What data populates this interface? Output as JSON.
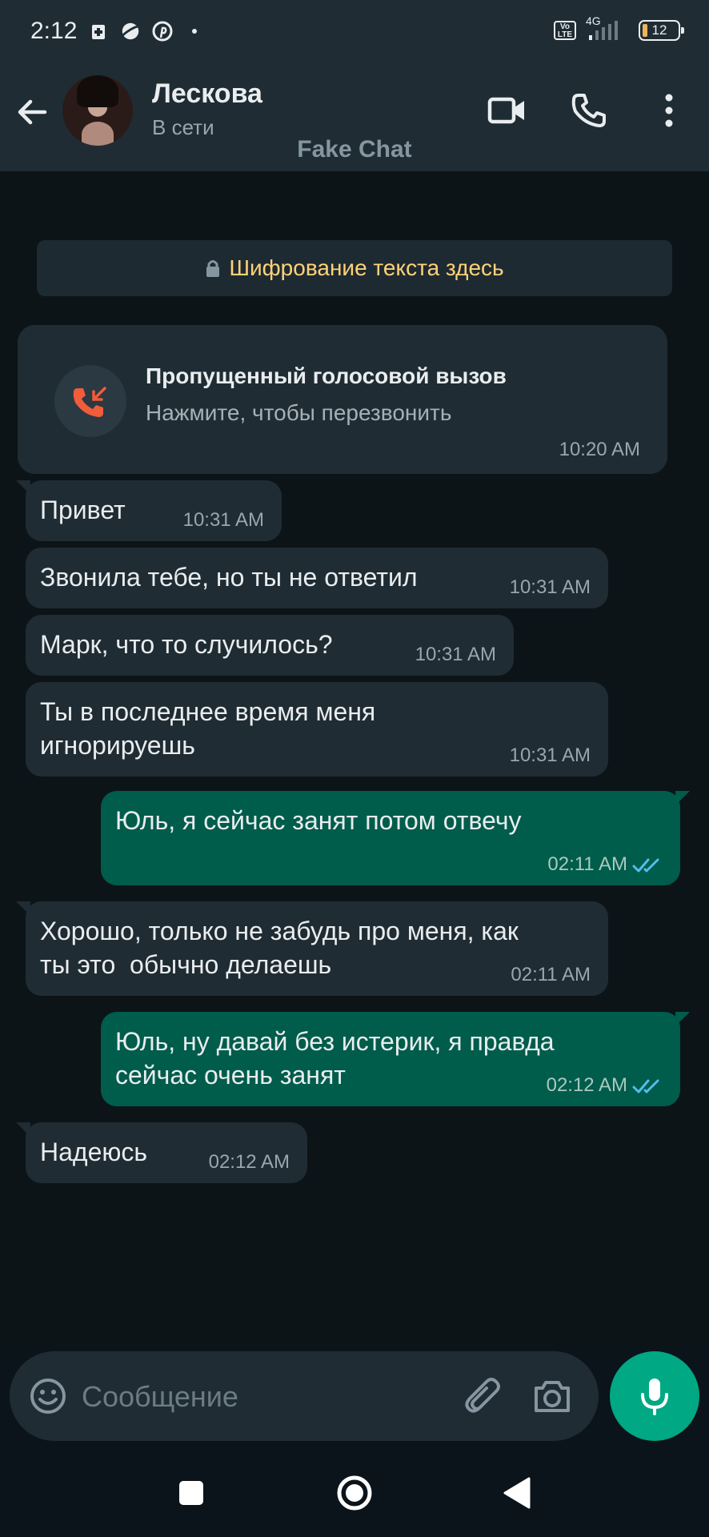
{
  "status_bar": {
    "time": "2:12",
    "network": "4G",
    "volte_label": "Vo LTE",
    "battery": "12",
    "battery_level": 0.12
  },
  "header": {
    "contact_name": "Лескова",
    "contact_status": "В сети",
    "watermark": "Fake Chat"
  },
  "encryption_notice": "Шифрование текста здесь",
  "missed_call": {
    "title": "Пропущенный голосовой вызов",
    "subtitle": "Нажмите, чтобы перезвонить",
    "time": "10:20 AM"
  },
  "messages": [
    {
      "direction": "in",
      "lines": [
        "Привет"
      ],
      "time": "10:31 AM"
    },
    {
      "direction": "in",
      "lines": [
        "Звонила тебе, но ты не ответил"
      ],
      "time": "10:31 AM"
    },
    {
      "direction": "in",
      "lines": [
        "Марк, что то случилось?"
      ],
      "time": "10:31 AM"
    },
    {
      "direction": "in",
      "lines": [
        "Ты в последнее время меня",
        "игнорируешь"
      ],
      "time": "10:31 AM"
    },
    {
      "direction": "out",
      "lines": [
        "Юль, я сейчас занят потом отвечу"
      ],
      "time": "02:11 AM",
      "status": "read"
    },
    {
      "direction": "in",
      "lines": [
        "Хорошо, только не забудь про меня, как",
        "ты это  обычно делаешь"
      ],
      "time": "02:11 AM"
    },
    {
      "direction": "out",
      "lines": [
        "Юль, ну давай без истерик, я правда",
        "сейчас очень занят"
      ],
      "time": "02:12 AM",
      "status": "read"
    },
    {
      "direction": "in",
      "lines": [
        "Надеюсь"
      ],
      "time": "02:12 AM"
    }
  ],
  "composer": {
    "placeholder": "Сообщение"
  },
  "colors": {
    "incoming_bubble": "#202c33",
    "outgoing_bubble": "#005c4b",
    "accent": "#00a884",
    "read_ticks": "#53bdeb",
    "missed_call": "#f15c3b",
    "encryption_text": "#ffd279"
  },
  "icons": {
    "back": "arrow-left-icon",
    "video": "video-call-icon",
    "voice": "phone-icon",
    "menu": "more-vert-icon",
    "lock": "lock-icon",
    "missed": "missed-call-icon",
    "emoji": "emoji-icon",
    "attach": "paperclip-icon",
    "camera": "camera-icon",
    "mic": "mic-icon"
  }
}
